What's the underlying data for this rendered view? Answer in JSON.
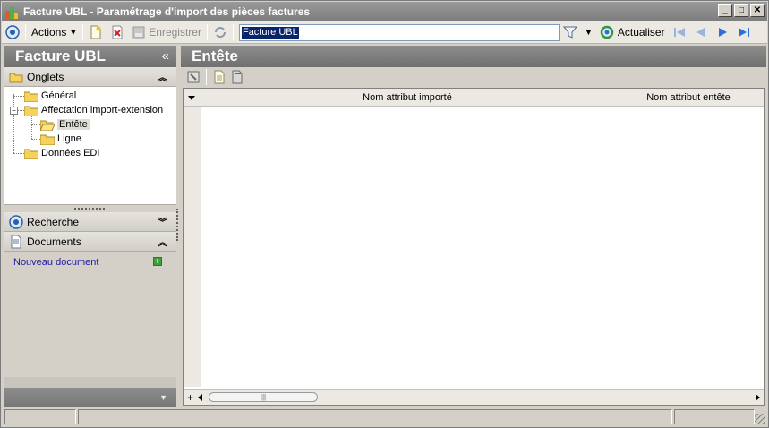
{
  "window": {
    "title": "Facture UBL - Paramétrage d'import des pièces factures",
    "minimize": "_",
    "maximize": "□",
    "close": "✕"
  },
  "toolbar": {
    "actions_label": "Actions",
    "save_label": "Enregistrer",
    "search_value": "Facture UBL",
    "refresh_label": "Actualiser"
  },
  "left": {
    "title": "Facture UBL",
    "collapse": "«",
    "tabs_section": "Onglets",
    "tree": [
      {
        "label": "Général"
      },
      {
        "label": "Affectation import-extension"
      },
      {
        "label": "Entête"
      },
      {
        "label": "Ligne"
      },
      {
        "label": "Données EDI"
      }
    ],
    "search_section": "Recherche",
    "documents_section": "Documents",
    "new_document": "Nouveau document"
  },
  "right": {
    "title": "Entête",
    "columns": [
      "Nom attribut importé",
      "Nom attribut entête"
    ],
    "scroll_plus": "+",
    "scroll_thumb": "|||"
  },
  "colors": {
    "header_gray": "#7c7c7c",
    "selection_blue": "#0a246a",
    "link_blue": "#1a1aa6",
    "nav_blue": "#2a6fdb"
  }
}
